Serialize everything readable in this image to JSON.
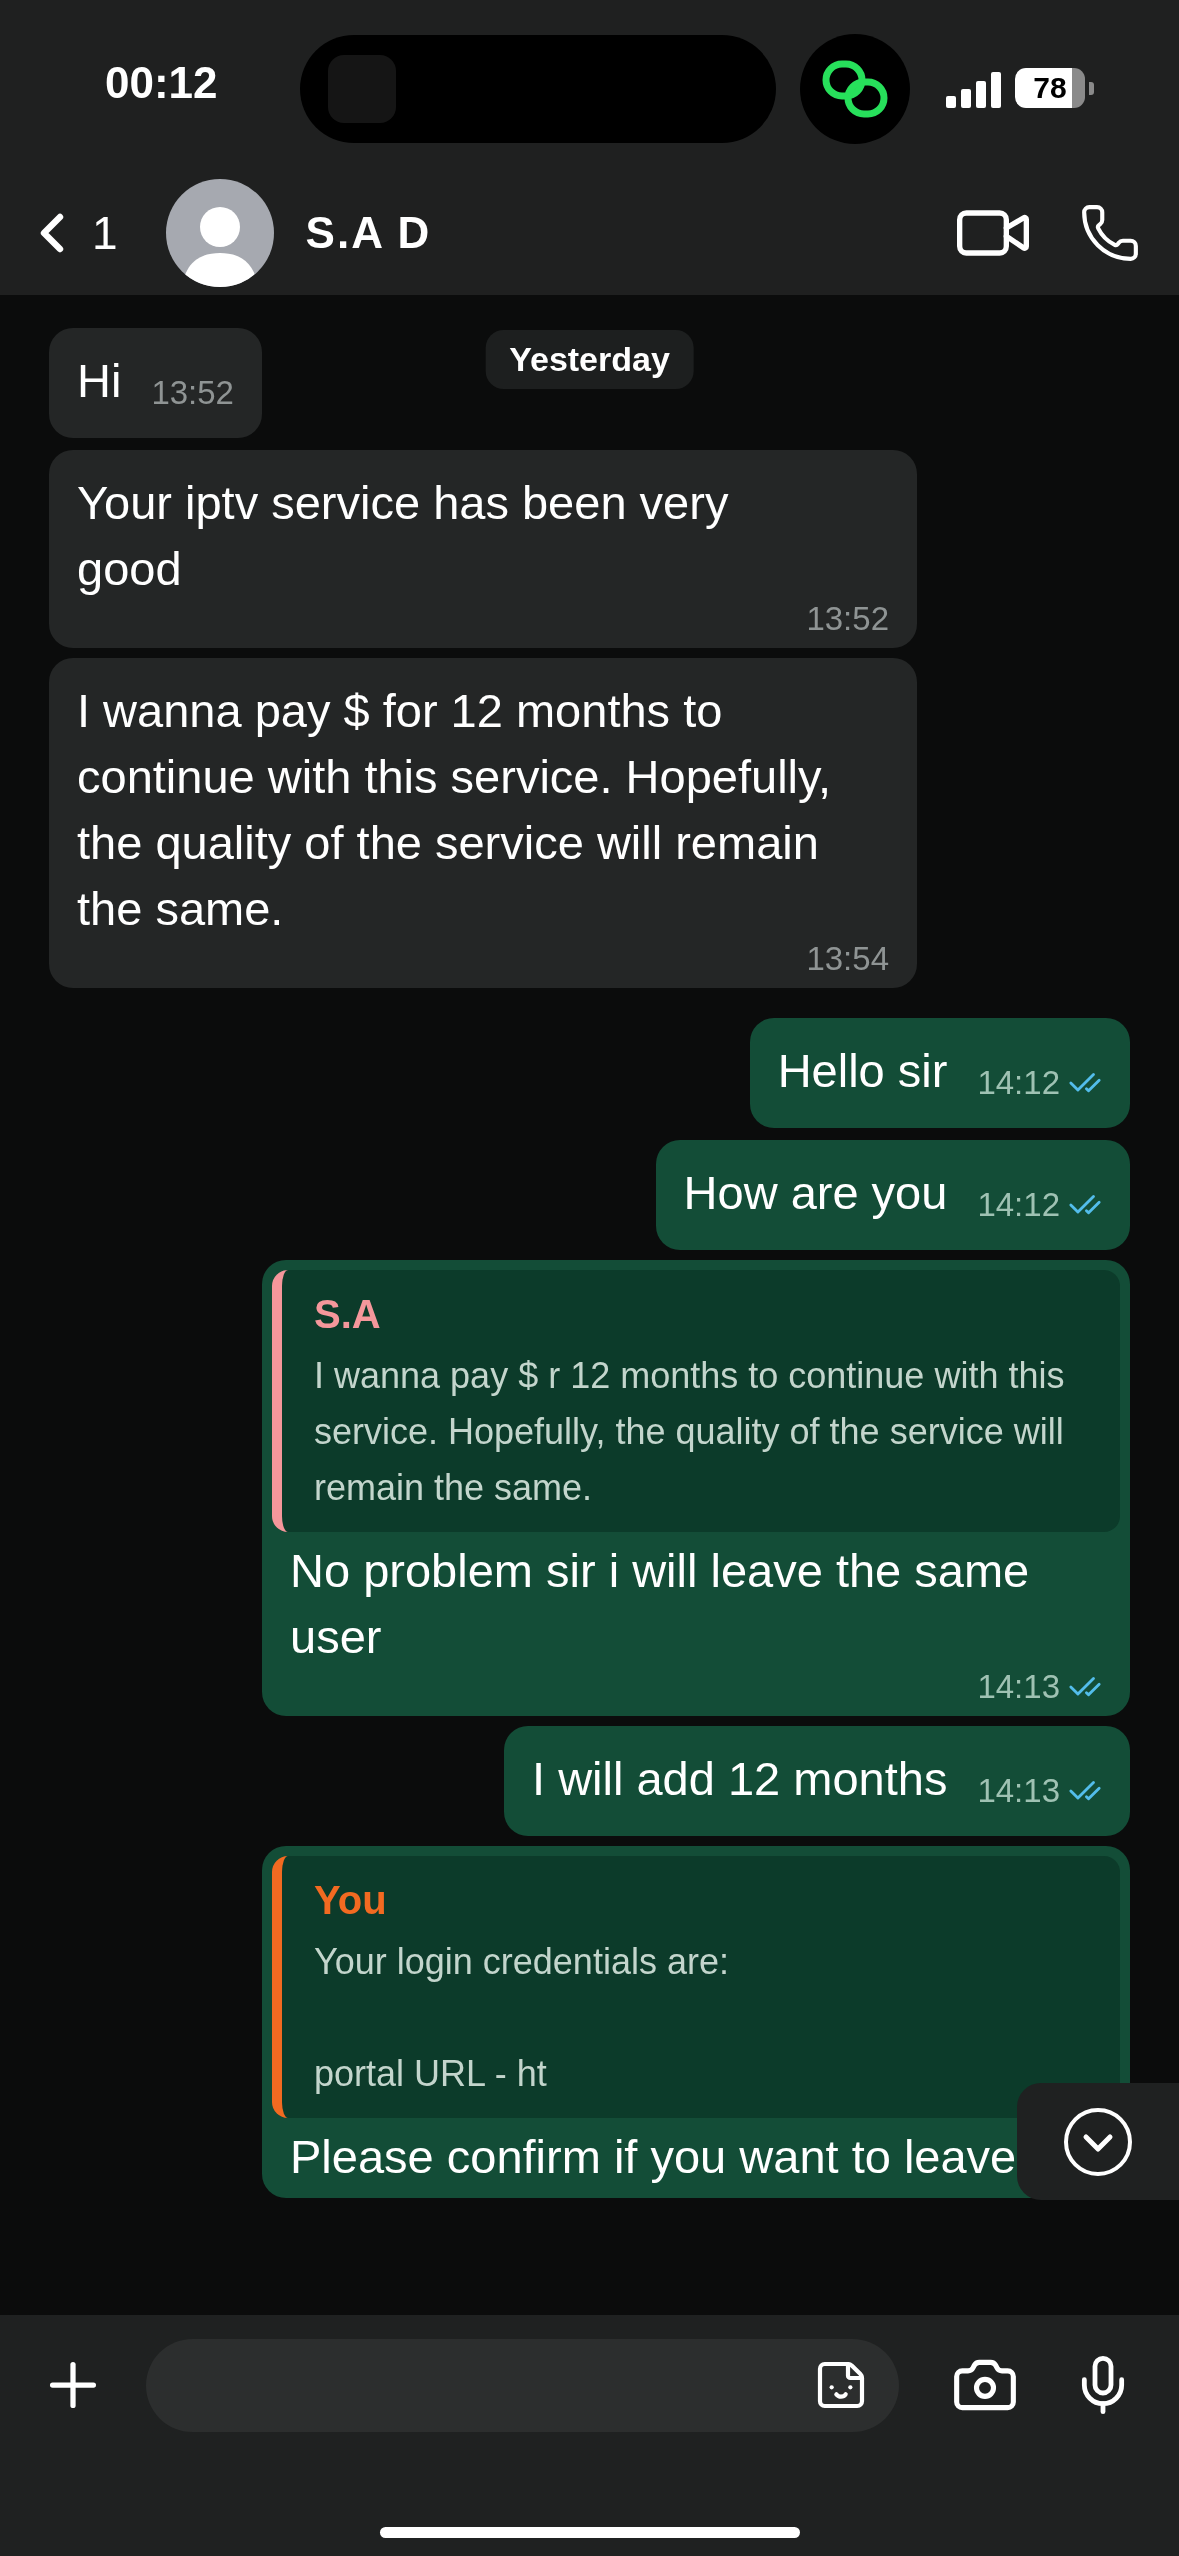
{
  "status_bar": {
    "time": "00:12",
    "battery": "78"
  },
  "header": {
    "back_count": "1",
    "contact_name": "S.A D"
  },
  "date_separator": "Yesterday",
  "messages": [
    {
      "kind": "text",
      "sent": false,
      "text": "Hi",
      "time": "13:52"
    },
    {
      "kind": "text",
      "sent": false,
      "text": "Your iptv service has been very good",
      "time": "13:52"
    },
    {
      "kind": "text",
      "sent": false,
      "text": "I wanna pay $ for 12 months to continue with this service. Hopefully, the quality of the service will remain the same.",
      "time": "13:54"
    },
    {
      "kind": "text",
      "sent": true,
      "text": "Hello sir",
      "time": "14:12",
      "read": true
    },
    {
      "kind": "text",
      "sent": true,
      "text": "How are you",
      "time": "14:12",
      "read": true
    },
    {
      "kind": "reply",
      "sent": true,
      "quote": {
        "author": "S.A",
        "color": "#f5979b",
        "lines": [
          "I wanna pay $ r 12 months to continue with this service. Hopefully, the quality of the service will remain the same."
        ]
      },
      "text": "No problem sir i will leave the same user",
      "time": "14:13",
      "read": true
    },
    {
      "kind": "text",
      "sent": true,
      "text": "I will add 12 months",
      "time": "14:13",
      "read": true
    },
    {
      "kind": "reply",
      "sent": true,
      "quote": {
        "author": "You",
        "color": "#f26a21",
        "lines": [
          "Your login credentials are:",
          "portal URL - ht"
        ]
      },
      "text": "Please confirm if you want to leave"
    }
  ]
}
